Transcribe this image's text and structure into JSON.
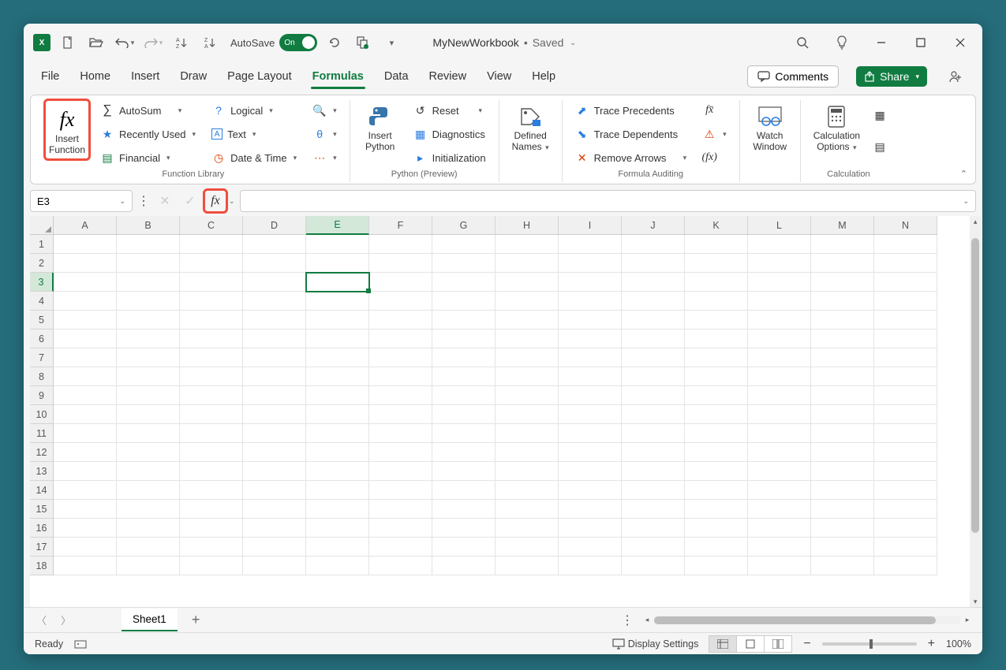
{
  "titlebar": {
    "autosave_label": "AutoSave",
    "autosave_state": "On",
    "doc_name": "MyNewWorkbook",
    "doc_sep": "•",
    "doc_status": "Saved"
  },
  "tabs": {
    "file": "File",
    "home": "Home",
    "insert": "Insert",
    "draw": "Draw",
    "page_layout": "Page Layout",
    "formulas": "Formulas",
    "data": "Data",
    "review": "Review",
    "view": "View",
    "help": "Help",
    "comments": "Comments",
    "share": "Share"
  },
  "ribbon": {
    "insert_function_l1": "Insert",
    "insert_function_l2": "Function",
    "autosum": "AutoSum",
    "recently_used": "Recently Used",
    "financial": "Financial",
    "logical": "Logical",
    "text": "Text",
    "date_time": "Date & Time",
    "group_function_library": "Function Library",
    "insert_python_l1": "Insert",
    "insert_python_l2": "Python",
    "reset": "Reset",
    "diagnostics": "Diagnostics",
    "initialization": "Initialization",
    "group_python": "Python (Preview)",
    "defined_names_l1": "Defined",
    "defined_names_l2": "Names",
    "trace_precedents": "Trace Precedents",
    "trace_dependents": "Trace Dependents",
    "remove_arrows": "Remove Arrows",
    "group_auditing": "Formula Auditing",
    "watch_window_l1": "Watch",
    "watch_window_l2": "Window",
    "calc_options_l1": "Calculation",
    "calc_options_l2": "Options",
    "group_calculation": "Calculation"
  },
  "formula_bar": {
    "name_box": "E3"
  },
  "grid": {
    "columns": [
      "A",
      "B",
      "C",
      "D",
      "E",
      "F",
      "G",
      "H",
      "I",
      "J",
      "K",
      "L",
      "M",
      "N"
    ],
    "rows": [
      "1",
      "2",
      "3",
      "4",
      "5",
      "6",
      "7",
      "8",
      "9",
      "10",
      "11",
      "12",
      "13",
      "14",
      "15",
      "16",
      "17",
      "18"
    ],
    "active_col": "E",
    "active_row": "3"
  },
  "sheets": {
    "sheet1": "Sheet1"
  },
  "statusbar": {
    "ready": "Ready",
    "display_settings": "Display Settings",
    "zoom": "100%"
  }
}
